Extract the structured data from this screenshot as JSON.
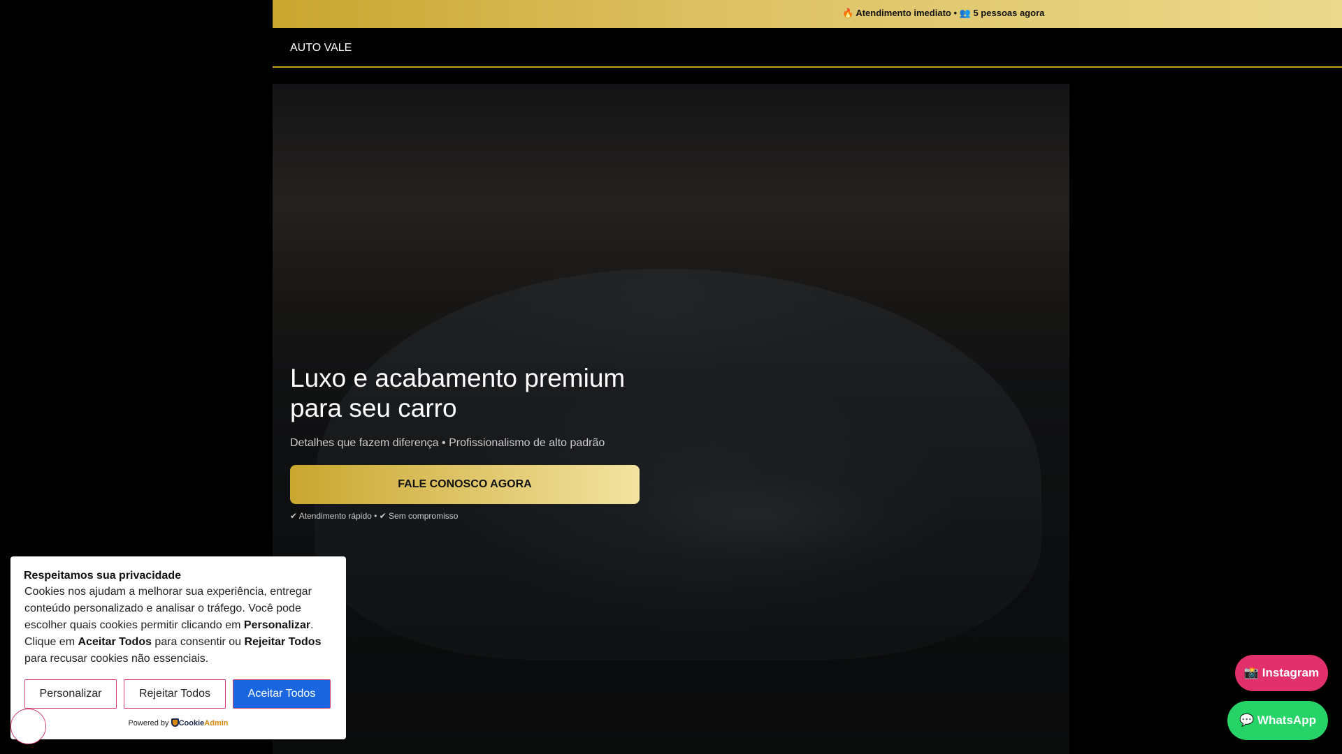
{
  "topbar": {
    "fire_icon": "🔥",
    "text1": "Atendimento imediato",
    "sep": "•",
    "people_icon": "👥",
    "text2": "5 pessoas agora"
  },
  "nav": {
    "brand": "AUTO VALE"
  },
  "hero": {
    "title": "Luxo e acabamento premium para seu carro",
    "subtitle": "Detalhes que fazem diferença • Profissionalismo de alto padrão",
    "cta": "FALE CONOSCO AGORA",
    "checks": "✔ Atendimento rápido • ✔ Sem compromisso"
  },
  "cookie": {
    "title": "Respeitamos sua privacidade",
    "t1": "Cookies nos ajudam a melhorar sua experiência, entregar conteúdo personalizado e analisar o tráfego. Você pode escolher quais cookies permitir clicando em ",
    "b1": "Personalizar",
    "t2": ". Clique em ",
    "b2": "Aceitar Todos",
    "t3": " para consentir ou ",
    "b3": "Rejeitar Todos",
    "t4": " para recusar cookies não essenciais.",
    "customize": "Personalizar",
    "reject": "Rejeitar Todos",
    "accept": "Aceitar Todos",
    "powered": "Powered by",
    "logo_a": "Cookie",
    "logo_b": "Admin"
  },
  "floating": {
    "instagram": "📸 Instagram",
    "whatsapp": "💬 WhatsApp"
  },
  "colors": {
    "gold": "#c9a227",
    "instagram": "#e1306c",
    "whatsapp": "#25d366",
    "accept": "#1a66e0"
  }
}
